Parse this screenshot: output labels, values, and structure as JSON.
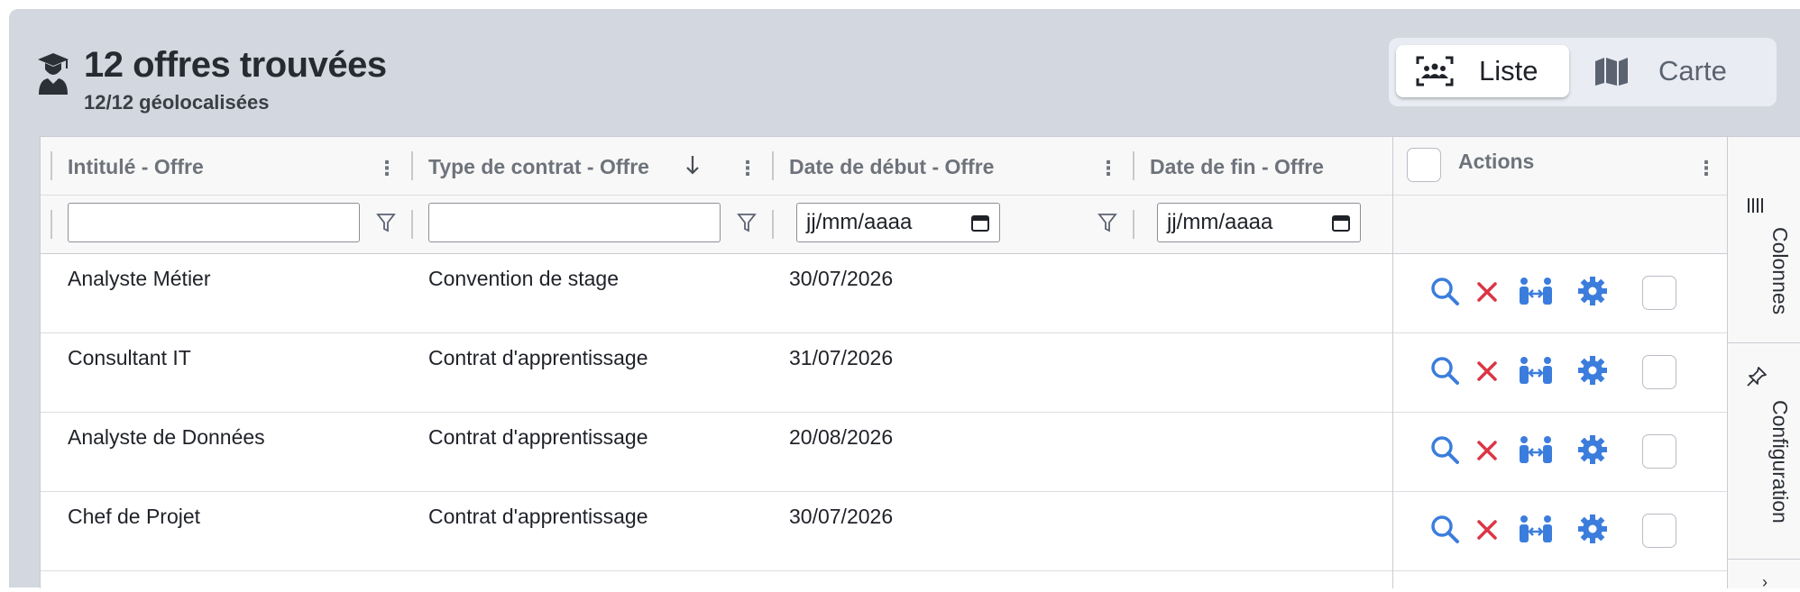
{
  "header": {
    "title": "12 offres trouvées",
    "subtitle": "12/12 géolocalisées",
    "icon": "student-icon"
  },
  "view_toggle": {
    "list_label": "Liste",
    "map_label": "Carte",
    "active": "Liste"
  },
  "grid": {
    "columns": [
      {
        "label": "Intitulé - Offre",
        "filter_type": "text"
      },
      {
        "label": "Type de contrat - Offre",
        "filter_type": "text",
        "sort": "descending"
      },
      {
        "label": "Date de début - Offre",
        "filter_type": "date"
      },
      {
        "label": "Date de fin - Offre",
        "filter_type": "date"
      }
    ],
    "date_placeholder": "jj/mm/aaaa",
    "actions_header": "Actions",
    "rows": [
      {
        "intitule": "Analyste Métier",
        "type_contrat": "Convention de stage",
        "date_debut": "30/07/2026",
        "date_fin": ""
      },
      {
        "intitule": "Consultant IT",
        "type_contrat": "Contrat d'apprentissage",
        "date_debut": "31/07/2026",
        "date_fin": ""
      },
      {
        "intitule": "Analyste de Données",
        "type_contrat": "Contrat d'apprentissage",
        "date_debut": "20/08/2026",
        "date_fin": ""
      },
      {
        "intitule": "Chef de Projet",
        "type_contrat": "Contrat d'apprentissage",
        "date_debut": "30/07/2026",
        "date_fin": ""
      }
    ],
    "row_actions": [
      "search-icon",
      "delete-icon",
      "match-icon",
      "settings-icon",
      "select-checkbox"
    ]
  },
  "side_panel": {
    "tabs": [
      "Colonnes",
      "Configuration"
    ]
  },
  "colors": {
    "panel_bg": "#d3d7e0",
    "action_blue": "#3b7ddd",
    "action_red": "#dc3545"
  }
}
